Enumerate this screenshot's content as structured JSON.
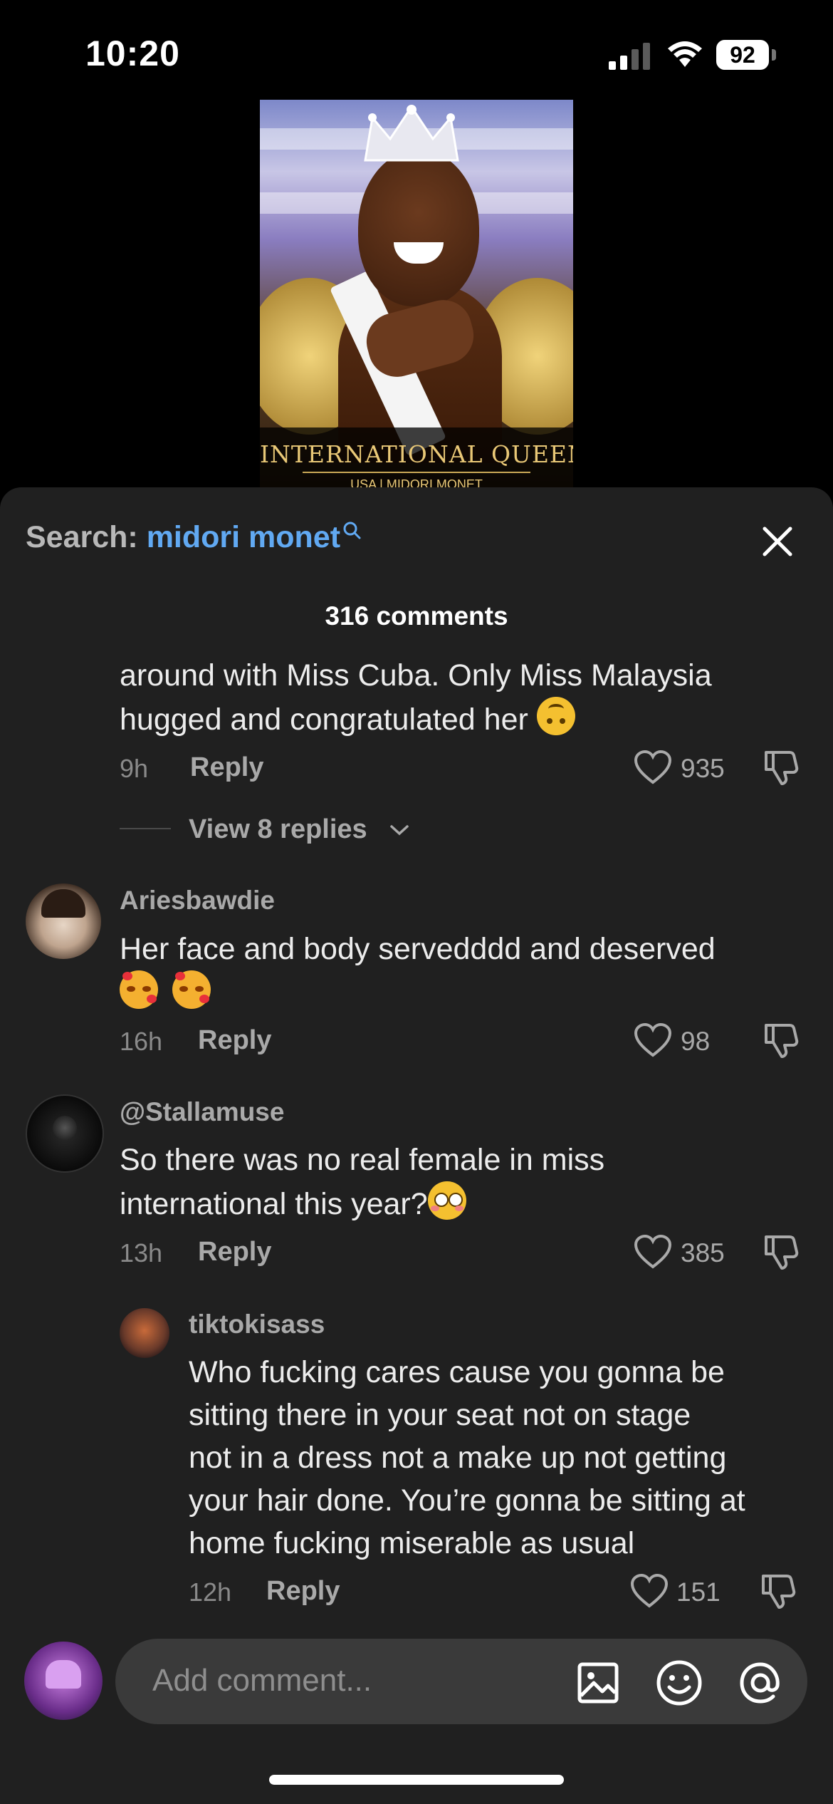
{
  "status": {
    "time": "10:20",
    "battery": "92"
  },
  "video": {
    "title": "INTERNATIONAL QUEEN",
    "subtitle": "USA | MIDORI MONET"
  },
  "search": {
    "label": "Search:",
    "term": "midori monet"
  },
  "comments_count": "316 comments",
  "comments": [
    {
      "text_lines": [
        "around with Miss Cuba. Only Miss Malaysia",
        "hugged and congratulated her"
      ],
      "time": "9h",
      "reply": "Reply",
      "likes": "935",
      "view_replies": "View 8 replies"
    },
    {
      "username": "Ariesbawdie",
      "text_lines": [
        "Her face and body servedddd and deserved"
      ],
      "time": "16h",
      "reply": "Reply",
      "likes": "98"
    },
    {
      "username": "@Stallamuse",
      "text_lines": [
        "So there was no real female in miss",
        "international this year?"
      ],
      "time": "13h",
      "reply": "Reply",
      "likes": "385"
    },
    {
      "username": "tiktokisass",
      "text_lines": [
        "Who fucking cares cause you gonna be",
        "sitting there in your seat not on stage",
        "not in a dress not a make up not getting",
        "your hair done. You’re gonna be sitting at",
        "home fucking miserable as usual"
      ],
      "time": "12h",
      "reply": "Reply",
      "likes": "151"
    }
  ],
  "input": {
    "placeholder": "Add comment..."
  },
  "icons": [
    "search-icon",
    "close-icon",
    "heart-icon",
    "dislike-icon",
    "image-icon",
    "emoji-icon",
    "at-icon",
    "chevron-down-icon"
  ],
  "colors": {
    "accent": "#61a9f2",
    "sheet": "#202020",
    "input": "#3a3a3a"
  }
}
